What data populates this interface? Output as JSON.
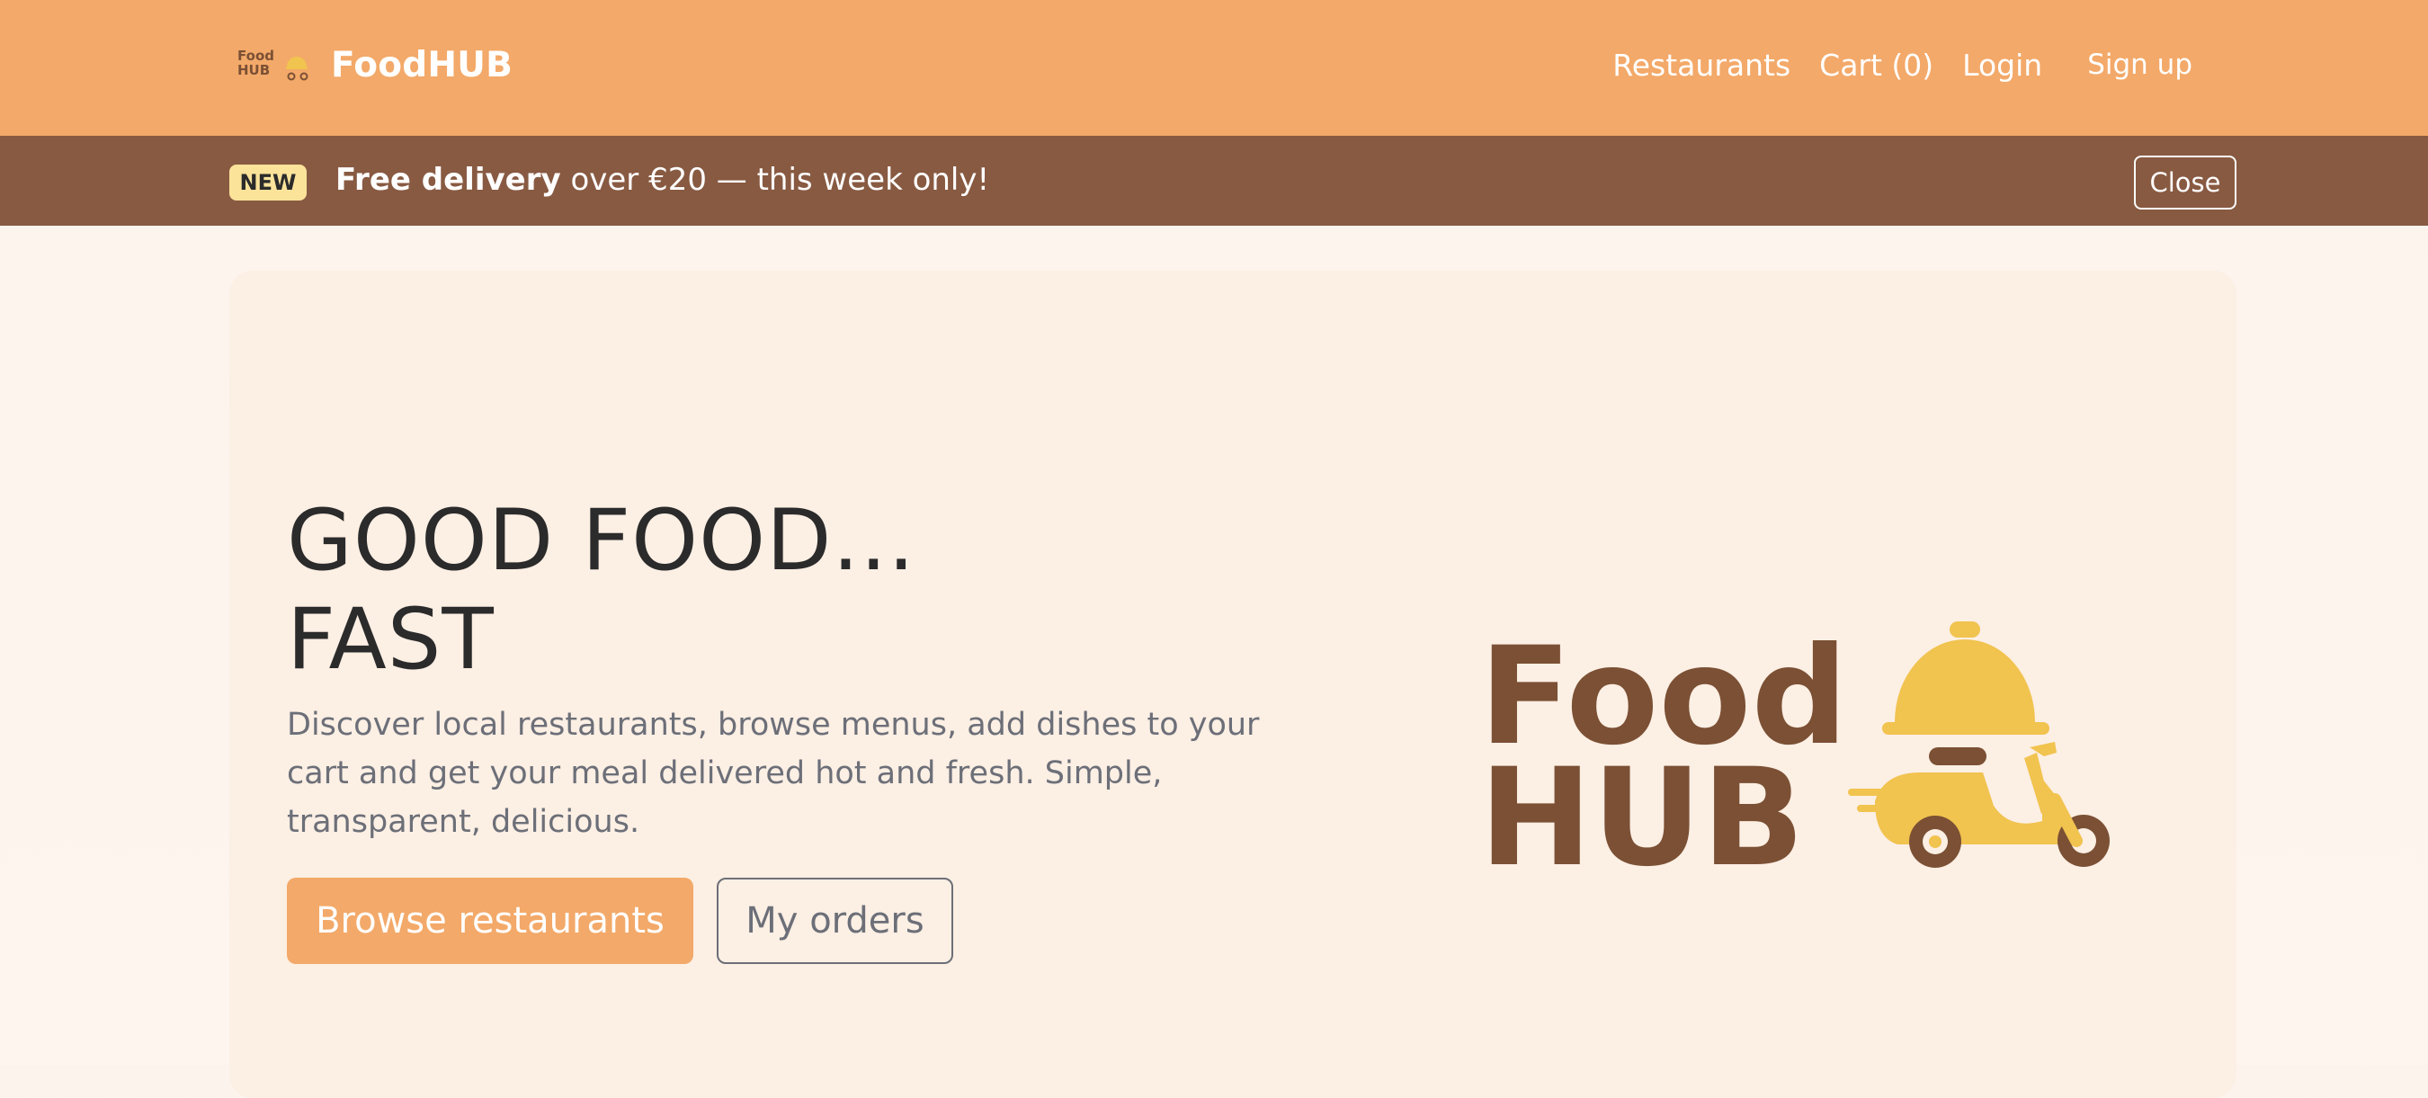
{
  "brand": {
    "name": "FoodHUB",
    "logo_word_1": "Food",
    "logo_word_2": "HUB"
  },
  "nav": {
    "restaurants": "Restaurants",
    "cart": "Cart (0)",
    "login": "Login",
    "signup": "Sign up"
  },
  "promo": {
    "badge": "NEW",
    "highlight": "Free delivery",
    "text": " over €20 — this week only!",
    "close_label": "Close"
  },
  "hero": {
    "title_line_1": "GOOD FOOD...",
    "title_line_2": "FAST",
    "description": "Discover local restaurants, browse menus, add dishes to your cart and get your meal delivered hot and fresh. Simple, transparent, delicious.",
    "primary_button": "Browse restaurants",
    "secondary_button": "My orders"
  },
  "colors": {
    "navbar": "#f3a969",
    "promo_bar": "#885a42",
    "badge": "#fbe39a",
    "logo_brown": "#7b5034",
    "logo_yellow": "#f1c34f",
    "hero_background": "#fcefe4"
  },
  "icons": {
    "logo": "food-delivery-scooter-cloche-icon"
  }
}
